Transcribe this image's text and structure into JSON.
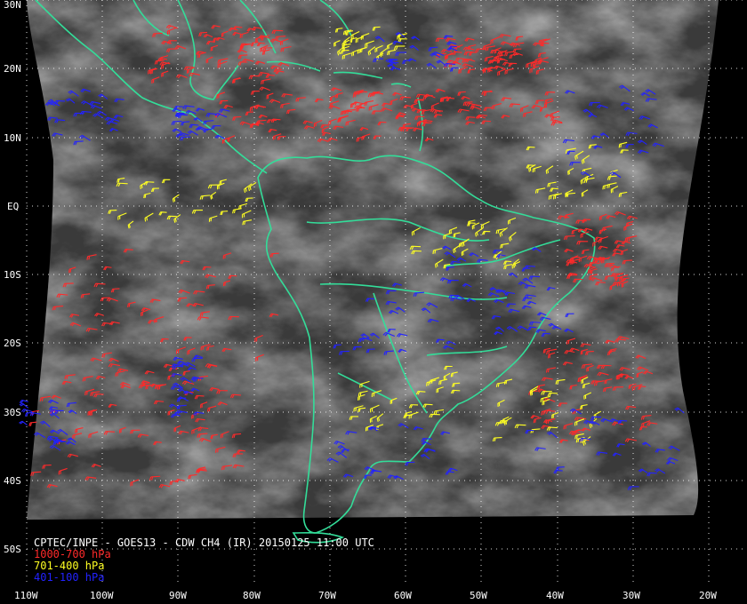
{
  "title": "CPTEC/INPE - GOES13 - CDW CH4 (IR) 20150125 11:00 UTC",
  "legend": [
    {
      "label": "1000-700 hPa",
      "color": "#ff2a2a"
    },
    {
      "label": "701-400 hPa",
      "color": "#ffff22"
    },
    {
      "label": "401-100 hPa",
      "color": "#2222ff"
    }
  ],
  "lat_labels": [
    "30N",
    "20N",
    "10N",
    "EQ",
    "10S",
    "20S",
    "30S",
    "40S",
    "50S"
  ],
  "lon_labels": [
    "110W",
    "100W",
    "90W",
    "80W",
    "70W",
    "60W",
    "50W",
    "40W",
    "30W",
    "20W"
  ],
  "colors": {
    "coastline": "#33dd99",
    "grid": "#ffffff",
    "label_text": "#ffffff",
    "background": "#000000"
  }
}
